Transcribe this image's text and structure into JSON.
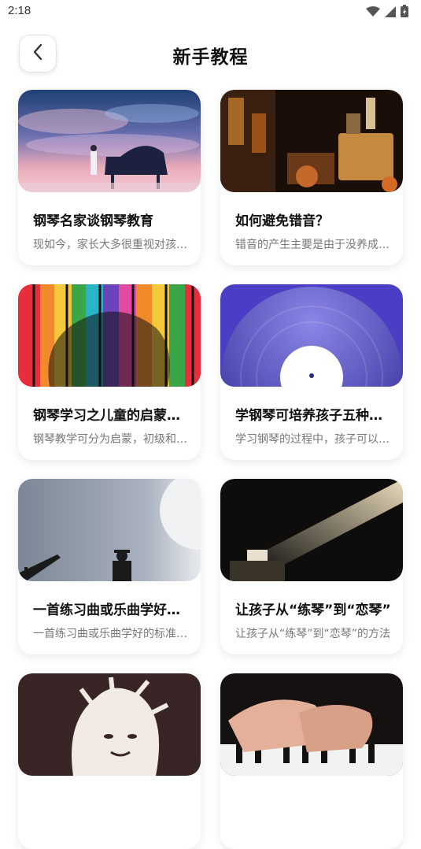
{
  "status_bar": {
    "time": "2:18",
    "icons": [
      "wifi-icon",
      "cell-signal-icon",
      "battery-icon"
    ]
  },
  "header": {
    "title": "新手教程",
    "back_icon": "chevron-left-icon"
  },
  "articles": [
    {
      "title": "钢琴名家谈钢琴教育",
      "desc": "现如今，家长大多很重视对孩子的教育"
    },
    {
      "title": "如何避免错音？",
      "desc": "错音的产生主要是由于没养成良好习惯"
    },
    {
      "title": "钢琴学习之儿童的启蒙教育",
      "desc": "钢琴教学可分为启蒙，初级和中级阶段"
    },
    {
      "title": "学钢琴可培养孩子五种能力",
      "desc": "学习钢琴的过程中，孩子可以学到很多"
    },
    {
      "title": "一首练习曲或乐曲学好的标准",
      "desc": "一首练习曲或乐曲学好的标准是什么"
    },
    {
      "title": "让孩子从“练琴”到“恋琴”",
      "desc": "让孩子从“练琴”到“恋琴”的方法"
    },
    {
      "title": "",
      "desc": ""
    },
    {
      "title": "",
      "desc": ""
    }
  ]
}
